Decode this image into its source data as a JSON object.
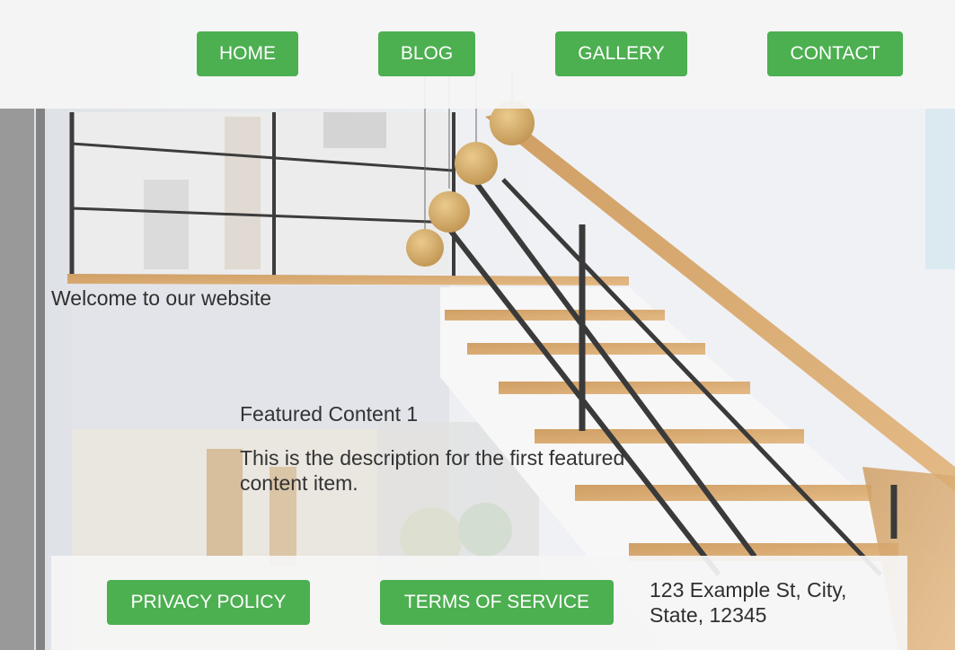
{
  "nav": {
    "items": [
      {
        "label": "HOME"
      },
      {
        "label": "BLOG"
      },
      {
        "label": "GALLERY"
      },
      {
        "label": "CONTACT"
      }
    ]
  },
  "hero": {
    "welcome": "Welcome to our website"
  },
  "featured": {
    "title": "Featured Content 1",
    "description": "This is the description for the first featured content item."
  },
  "footer": {
    "links": [
      {
        "label": "PRIVACY POLICY"
      },
      {
        "label": "TERMS OF SERVICE"
      }
    ],
    "address": "123 Example St, City, State, 12345"
  },
  "colors": {
    "button": "#4caf50",
    "button_text": "#ffffff",
    "text": "#333333",
    "panel": "#f5f5f5"
  }
}
